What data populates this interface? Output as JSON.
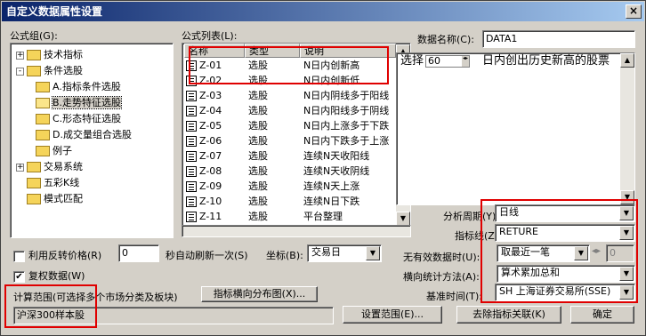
{
  "window": {
    "title": "自定义数据属性设置",
    "close_label": "×"
  },
  "left": {
    "group_label": "公式组(G):",
    "tree": [
      {
        "label": "技术指标",
        "expander": "+",
        "indent": 0
      },
      {
        "label": "条件选股",
        "expander": "-",
        "indent": 0
      },
      {
        "label": "A.指标条件选股",
        "expander": "",
        "indent": 1
      },
      {
        "label": "B.走势特征选股",
        "expander": "",
        "indent": 1,
        "selected": true
      },
      {
        "label": "C.形态特征选股",
        "expander": "",
        "indent": 1
      },
      {
        "label": "D.成交量组合选股",
        "expander": "",
        "indent": 1
      },
      {
        "label": "例子",
        "expander": "",
        "indent": 1
      },
      {
        "label": "交易系统",
        "expander": "+",
        "indent": 0
      },
      {
        "label": "五彩K线",
        "expander": "",
        "indent": 0
      },
      {
        "label": "模式匹配",
        "expander": "",
        "indent": 0
      }
    ]
  },
  "formula_list": {
    "label": "公式列表(L):",
    "columns": [
      "名称",
      "类型",
      "说明"
    ],
    "rows": [
      {
        "name": "Z-01",
        "type": "选股",
        "desc": "N日内创新高"
      },
      {
        "name": "Z-02",
        "type": "选股",
        "desc": "N日内创新低"
      },
      {
        "name": "Z-03",
        "type": "选股",
        "desc": "N日内阴线多于阳线"
      },
      {
        "name": "Z-04",
        "type": "选股",
        "desc": "N日内阳线多于阴线"
      },
      {
        "name": "Z-05",
        "type": "选股",
        "desc": "N日内上涨多于下跌"
      },
      {
        "name": "Z-06",
        "type": "选股",
        "desc": "N日内下跌多于上涨"
      },
      {
        "name": "Z-07",
        "type": "选股",
        "desc": "连续N天收阳线"
      },
      {
        "name": "Z-08",
        "type": "选股",
        "desc": "连续N天收阴线"
      },
      {
        "name": "Z-09",
        "type": "选股",
        "desc": "连续N天上涨"
      },
      {
        "name": "Z-10",
        "type": "选股",
        "desc": "连续N日下跌"
      },
      {
        "name": "Z-11",
        "type": "选股",
        "desc": "平台整理"
      }
    ]
  },
  "right": {
    "data_name_label": "数据名称(C):",
    "data_name_value": "DATA1",
    "param_text_1": "选择",
    "param_value": "60",
    "param_text_2": "日内创出历史新高的股票",
    "period_label": "分析周期(Y):",
    "period_value": "日线",
    "indicator_label": "指标线(Z):",
    "indicator_value": "RETURE",
    "invalid_label": "无有效数据时(U):",
    "invalid_value": "取最近一笔",
    "invalid_num": "0",
    "stat_label": "横向统计方法(A):",
    "stat_value": "算术累加总和",
    "base_time_label": "基准时间(T):",
    "base_time_value": "SH 上海证券交易所(SSE)"
  },
  "bottom": {
    "reverse_price_label": "利用反转价格(R)",
    "reverse_price_checked": "",
    "refresh_value": "0",
    "refresh_label": "秒自动刷新一次(S)",
    "coord_label": "坐标(B):",
    "coord_value": "交易日",
    "adj_label": "复权数据(W)",
    "adj_checked": "✔",
    "range_label": "计算范围(可选择多个市场分类及板块)",
    "dist_button": "指标横向分布图(X)...",
    "range_value": "沪深300样本股",
    "set_range_button": "设置范围(E)...",
    "remove_button": "去除指标关联(K)",
    "ok_button": "确定"
  }
}
